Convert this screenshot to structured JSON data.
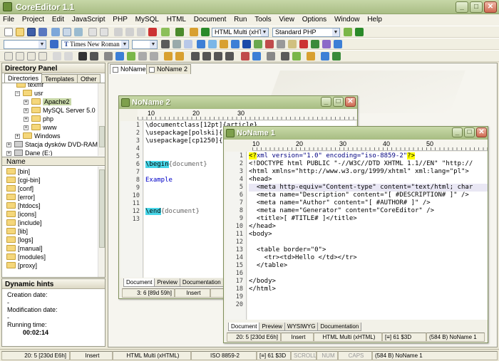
{
  "app": {
    "title": "CoreEditor 1.1"
  },
  "menu": [
    "File",
    "Project",
    "Edit",
    "JavaScript",
    "PHP",
    "MySQL",
    "HTML",
    "Document",
    "Run",
    "Tools",
    "View",
    "Options",
    "Window",
    "Help"
  ],
  "toolbar": {
    "html_mode": "HTML Multi (xHTML)",
    "php_mode": "Standard PHP",
    "font": "Times New Roman"
  },
  "doc_tabs": [
    "NoName 1",
    "NoName 2"
  ],
  "directory_panel": {
    "title": "Directory Panel",
    "tabs": [
      "Directories",
      "Templates",
      "Other"
    ],
    "tree": [
      {
        "label": "texmf",
        "indent": 1,
        "expander": false
      },
      {
        "label": "usr",
        "indent": 1,
        "expander": true
      },
      {
        "label": "Apache2",
        "indent": 2,
        "expander": true,
        "selected": true
      },
      {
        "label": "MySQL Server 5.0",
        "indent": 2,
        "expander": true
      },
      {
        "label": "php",
        "indent": 2,
        "expander": true
      },
      {
        "label": "www",
        "indent": 2,
        "expander": true
      },
      {
        "label": "Windows",
        "indent": 1,
        "expander": true
      },
      {
        "label": "Stacja dysków DVD-RAM (D:)",
        "indent": 0,
        "expander": true,
        "drive": true
      },
      {
        "label": "Dane (E:)",
        "indent": 0,
        "expander": true,
        "drive": true
      }
    ],
    "list_header": "Name",
    "files": [
      "[bin]",
      "[cgi-bin]",
      "[conf]",
      "[error]",
      "[htdocs]",
      "[icons]",
      "[include]",
      "[lib]",
      "[logs]",
      "[manual]",
      "[modules]",
      "[proxy]"
    ]
  },
  "dynamic_hints": {
    "title": "Dynamic hints",
    "creation_label": "Creation date:",
    "creation_value": "-",
    "modification_label": "Modification date:",
    "modification_value": "-",
    "running_label": "Running time:",
    "running_value": "00:02:14"
  },
  "window2": {
    "title": "NoName 2",
    "ruler": [
      "10",
      "20",
      "30"
    ],
    "line_numbers": [
      "1",
      "2",
      "3",
      "4",
      "5",
      "6",
      "7",
      "8",
      "9",
      "10",
      "11",
      "12",
      "13"
    ],
    "lines": [
      {
        "n": 1,
        "segs": [
          {
            "t": "\\documentclass[12pt]{article}"
          }
        ]
      },
      {
        "n": 2,
        "segs": [
          {
            "t": "\\usepackage[polski]{babel}"
          }
        ]
      },
      {
        "n": 3,
        "segs": [
          {
            "t": "\\usepackage[cp1250]{inputenc}"
          }
        ]
      },
      {
        "n": 6,
        "segs": [
          {
            "t": "\\begin",
            "c": "hlb"
          },
          {
            "t": "{document}",
            "c": "cm"
          }
        ]
      },
      {
        "n": 8,
        "segs": [
          {
            "t": "Example",
            "c": "st"
          }
        ]
      },
      {
        "n": 12,
        "segs": [
          {
            "t": "\\end",
            "c": "hlb"
          },
          {
            "t": "{document}",
            "c": "cm"
          }
        ]
      }
    ],
    "bottom_tabs": [
      "Document",
      "Preview",
      "Documentation"
    ],
    "status": {
      "pos": "3: 6 [89d 59h]",
      "mode": "Insert"
    }
  },
  "window1": {
    "title": "NoName 1",
    "ruler": [
      "10",
      "20",
      "30",
      "40",
      "50"
    ],
    "line_numbers": [
      "1",
      "2",
      "3",
      "4",
      "5",
      "6",
      "7",
      "8",
      "9",
      "10",
      "11",
      "12",
      "13",
      "14",
      "15",
      "16",
      "17",
      "18",
      "19",
      "20"
    ],
    "lines": [
      {
        "segs": [
          {
            "t": "<?",
            "c": "hlp"
          },
          {
            "t": "xml version=\"1.0\" encoding=\"iso-8859-2\"",
            "c": "kw"
          },
          {
            "t": "?>",
            "c": "hlp"
          }
        ]
      },
      {
        "segs": [
          {
            "t": "<!DOCTYPE html PUBLIC \"-//W3C//DTD XHTML 1.1//EN\" \"http://"
          }
        ]
      },
      {
        "segs": [
          {
            "t": "<html xmlns=\"http://www.w3.org/1999/xhtml\" xml:lang=\"pl\">"
          }
        ]
      },
      {
        "segs": [
          {
            "t": "<head>"
          }
        ]
      },
      {
        "row": "hlr",
        "segs": [
          {
            "t": "  <meta http-equiv=\"Content-type\" content=\"text/html; char"
          }
        ]
      },
      {
        "segs": [
          {
            "t": "  <meta name=\"Description\" content=\"[ #DESCRIPTION# ]\" />"
          }
        ]
      },
      {
        "segs": [
          {
            "t": "  <meta name=\"Author\" content=\"[ #AUTHOR# ]\" />"
          }
        ]
      },
      {
        "segs": [
          {
            "t": "  <meta name=\"Generator\" content=\"CoreEditor\" />"
          }
        ]
      },
      {
        "segs": [
          {
            "t": "  <title>[ #TITLE# ]</title>"
          }
        ]
      },
      {
        "segs": [
          {
            "t": "</head>"
          }
        ]
      },
      {
        "segs": [
          {
            "t": "<body>"
          }
        ]
      },
      {
        "segs": [
          {
            "t": ""
          }
        ]
      },
      {
        "segs": [
          {
            "t": "  <table border=\"0\">"
          }
        ]
      },
      {
        "segs": [
          {
            "t": "    <tr><td>Hello </td></tr>"
          }
        ]
      },
      {
        "segs": [
          {
            "t": "  </table>"
          }
        ]
      },
      {
        "segs": [
          {
            "t": ""
          }
        ]
      },
      {
        "segs": [
          {
            "t": "</body>"
          }
        ]
      },
      {
        "segs": [
          {
            "t": "</html>"
          }
        ]
      },
      {
        "segs": [
          {
            "t": ""
          }
        ]
      },
      {
        "segs": [
          {
            "t": ""
          }
        ]
      }
    ],
    "bottom_tabs": [
      "Document",
      "Preview",
      "WYSIWYG",
      "Documentation"
    ],
    "status": {
      "pos": "20: 5 [230d E6h]",
      "mode": "Insert",
      "syntax": "HTML Multi (xHTML)",
      "chars": "[≡] 61 $3D",
      "size": "(584 B) NoName 1"
    }
  },
  "statusbar": {
    "pos": "20: 5 [230d E6h]",
    "mode": "Insert",
    "syntax": "HTML Multi (xHTML)",
    "encoding": "ISO 8859-2",
    "chars": "[≡] 61 $3D",
    "scroll": "SCROLL",
    "num": "NUM",
    "caps": "CAPS",
    "file": "(584 B) NoName 1"
  }
}
